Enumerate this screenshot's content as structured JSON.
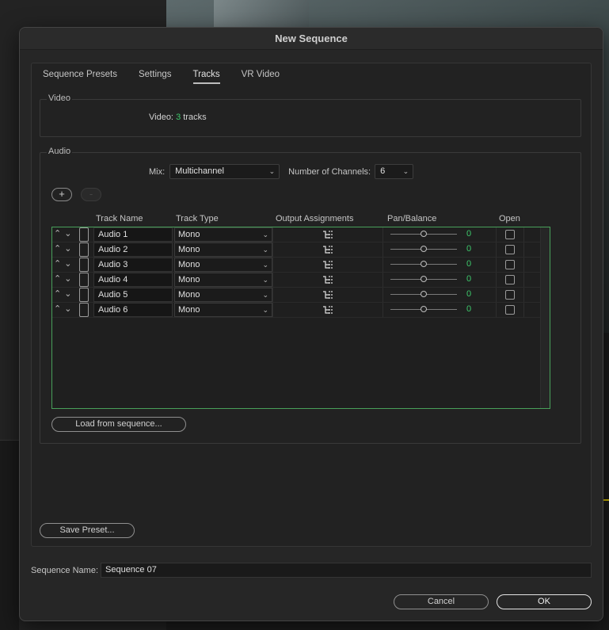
{
  "dialog": {
    "title": "New Sequence"
  },
  "tabs": [
    {
      "label": "Sequence Presets"
    },
    {
      "label": "Settings"
    },
    {
      "label": "Tracks",
      "active": true
    },
    {
      "label": "VR Video"
    }
  ],
  "video": {
    "group_label": "Video",
    "label": "Video:",
    "count": "3",
    "unit": "tracks"
  },
  "audio": {
    "group_label": "Audio",
    "mix_label": "Mix:",
    "mix_value": "Multichannel",
    "channels_label": "Number of Channels:",
    "channels_value": "6",
    "add_button": "+",
    "remove_button": "-",
    "columns": {
      "track_name": "Track Name",
      "track_type": "Track Type",
      "output_assignments": "Output Assignments",
      "pan_balance": "Pan/Balance",
      "open": "Open"
    },
    "tracks": [
      {
        "name": "Audio 1",
        "type": "Mono",
        "pan": "0"
      },
      {
        "name": "Audio 2",
        "type": "Mono",
        "pan": "0"
      },
      {
        "name": "Audio 3",
        "type": "Mono",
        "pan": "0"
      },
      {
        "name": "Audio 4",
        "type": "Mono",
        "pan": "0"
      },
      {
        "name": "Audio 5",
        "type": "Mono",
        "pan": "0"
      },
      {
        "name": "Audio 6",
        "type": "Mono",
        "pan": "0"
      }
    ],
    "load_button": "Load from sequence..."
  },
  "save_preset_button": "Save Preset...",
  "sequence_name": {
    "label": "Sequence Name:",
    "value": "Sequence 07"
  },
  "buttons": {
    "cancel": "Cancel",
    "ok": "OK"
  },
  "colors": {
    "accent_value": "#3dc96b",
    "list_border": "#48a05a"
  }
}
